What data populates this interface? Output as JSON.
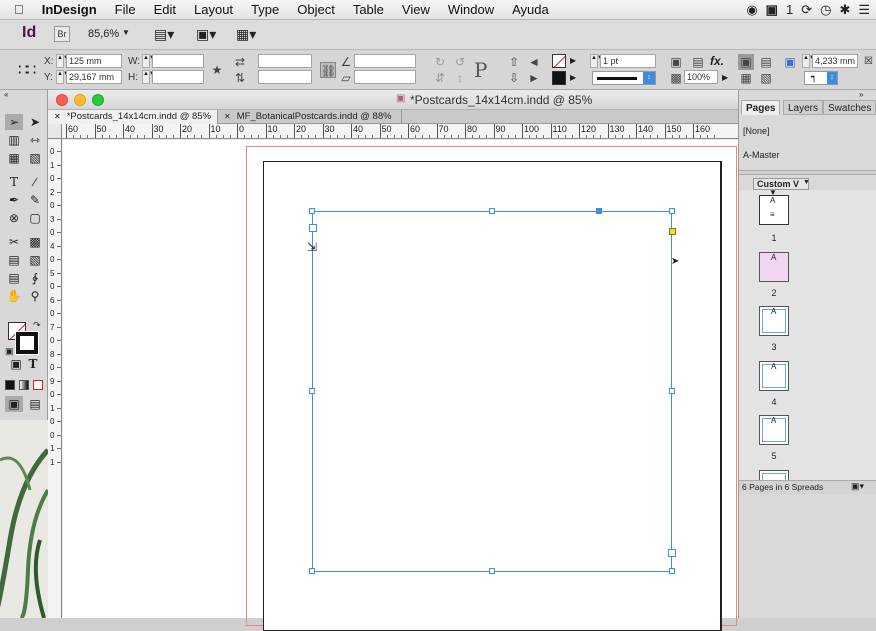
{
  "menubar": {
    "app_name": "InDesign",
    "items": [
      "File",
      "Edit",
      "Layout",
      "Type",
      "Object",
      "Table",
      "View",
      "Window",
      "Ayuda"
    ],
    "status_number": "1"
  },
  "appbar": {
    "logo": "Id",
    "bridge": "Br",
    "zoom": "85,6%"
  },
  "control": {
    "x_label": "X:",
    "x_value": "125 mm",
    "y_label": "Y:",
    "y_value": "29,167 mm",
    "w_label": "W:",
    "h_label": "H:",
    "stroke_weight": "1 pt",
    "opacity": "100%",
    "offset_value": "4,233 mm"
  },
  "document": {
    "window_title": "*Postcards_14x14cm.indd @ 85%",
    "tabs": [
      "*Postcards_14x14cm.indd @ 85%",
      "MF_BotanicalPostcards.indd @ 88%"
    ],
    "ruler_top_ticks": [
      "60",
      "50",
      "40",
      "30",
      "20",
      "10",
      "0",
      "10",
      "20",
      "30",
      "40",
      "50",
      "60",
      "70",
      "80",
      "90",
      "100",
      "110",
      "120",
      "130",
      "140",
      "150",
      "160"
    ],
    "ruler_left_ticks": [
      "0",
      "1",
      "0",
      "2",
      "0",
      "3",
      "0",
      "4",
      "0",
      "5",
      "0",
      "6",
      "0",
      "7",
      "0",
      "8",
      "0",
      "9",
      "0",
      "1",
      "0",
      "0",
      "1",
      "1"
    ]
  },
  "panel": {
    "tabs": [
      "Pages",
      "Layers",
      "Swatches"
    ],
    "none_label": "[None]",
    "master_label": "A-Master",
    "view_dropdown": "Custom V",
    "pages": [
      {
        "number": "1",
        "master": "A"
      },
      {
        "number": "2",
        "master": "A"
      },
      {
        "number": "3",
        "master": "A"
      },
      {
        "number": "4",
        "master": "A"
      },
      {
        "number": "5",
        "master": "A"
      }
    ],
    "footer": "6 Pages in 6 Spreads"
  },
  "colors": {
    "selection_blue": "#3f8fe0",
    "bleed_red": "#e88585",
    "master_pink": "#f0d6ee"
  }
}
